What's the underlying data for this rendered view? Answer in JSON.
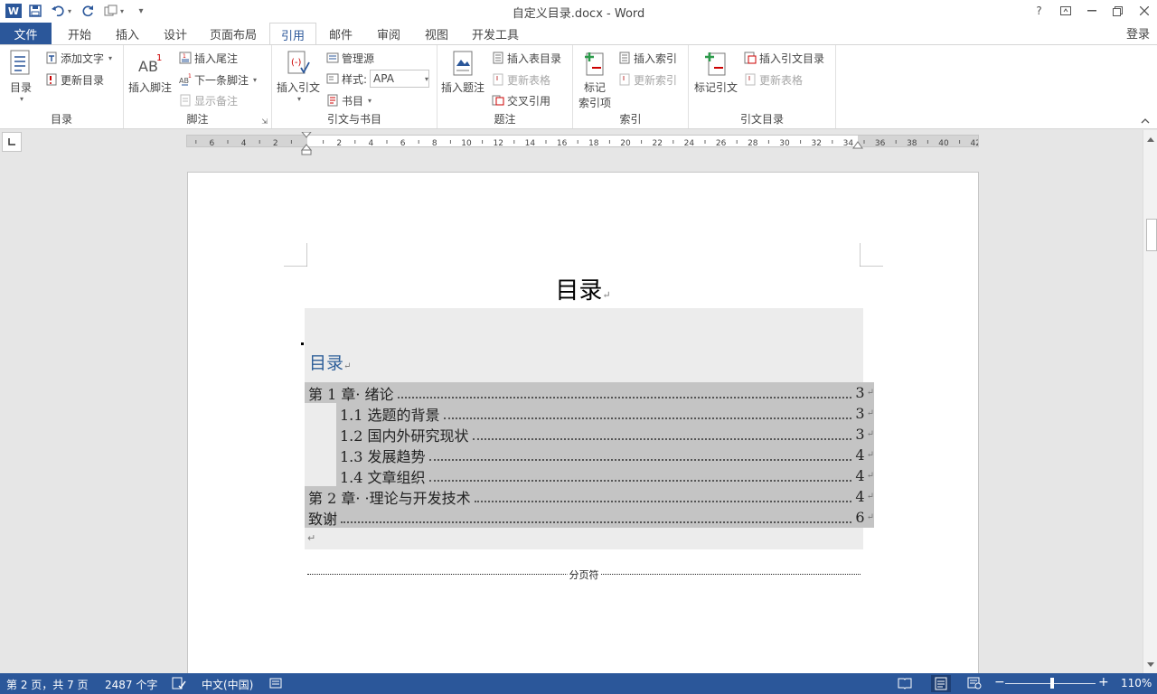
{
  "window": {
    "title": "自定义目录.docx - Word",
    "login": "登录",
    "controls": {
      "help": "?",
      "restore_ribbon": "⊡",
      "minimize": "—",
      "maximize": "❐",
      "close": "✕"
    }
  },
  "qat": {
    "app": "W",
    "save": "💾",
    "undo": "↶",
    "redo": "↻",
    "customize": "▾"
  },
  "tabs": {
    "file": "文件",
    "items": [
      "开始",
      "插入",
      "设计",
      "页面布局",
      "引用",
      "邮件",
      "审阅",
      "视图",
      "开发工具"
    ],
    "active": "引用"
  },
  "ribbon": {
    "toc_group": {
      "label": "目录",
      "toc_button": "目录",
      "add_text": "添加文字",
      "update_toc": "更新目录"
    },
    "footnote_group": {
      "label": "脚注",
      "insert_footnote": "插入脚注",
      "insert_endnote": "插入尾注",
      "next_footnote": "下一条脚注",
      "show_notes": "显示备注"
    },
    "citation_group": {
      "label": "引文与书目",
      "insert_citation": "插入引文",
      "manage_sources": "管理源",
      "style_label": "样式:",
      "style_value": "APA",
      "bibliography": "书目"
    },
    "caption_group": {
      "label": "题注",
      "insert_caption": "插入题注",
      "insert_table_of_figures": "插入表目录",
      "update_table": "更新表格",
      "cross_reference": "交叉引用"
    },
    "index_group": {
      "label": "索引",
      "mark_entry_line1": "标记",
      "mark_entry_line2": "索引项",
      "insert_index": "插入索引",
      "update_index": "更新索引"
    },
    "authorities_group": {
      "label": "引文目录",
      "mark_citation": "标记引文",
      "insert_toa": "插入引文目录",
      "update_table": "更新表格"
    }
  },
  "ruler": {
    "labels": [
      "6",
      "4",
      "2",
      "2",
      "4",
      "6",
      "8",
      "10",
      "12",
      "14",
      "16",
      "18",
      "20",
      "22",
      "24",
      "26",
      "28",
      "30",
      "32",
      "34",
      "36",
      "38",
      "40",
      "42"
    ]
  },
  "document": {
    "heading": "目录",
    "toc_label": "目录",
    "entries": [
      {
        "text": "第 1 章· 绪论",
        "page": "3",
        "level": 1
      },
      {
        "text": "1.1 选题的背景",
        "page": "3",
        "level": 2
      },
      {
        "text": "1.2 国内外研究现状",
        "page": "3",
        "level": 2
      },
      {
        "text": "1.3 发展趋势",
        "page": "4",
        "level": 2
      },
      {
        "text": "1.4 文章组织",
        "page": "4",
        "level": 2
      },
      {
        "text": "第 2 章· ·理论与开发技术",
        "page": "4",
        "level": 1
      },
      {
        "text": "致谢",
        "page": "6",
        "level": 1
      }
    ],
    "page_break_label": "分页符",
    "para_mark": "↵"
  },
  "statusbar": {
    "page": "第 2 页，共 7 页",
    "words": "2487 个字",
    "language": "中文(中国)",
    "zoom": "110%",
    "zoom_minus": "−",
    "zoom_plus": "+"
  }
}
